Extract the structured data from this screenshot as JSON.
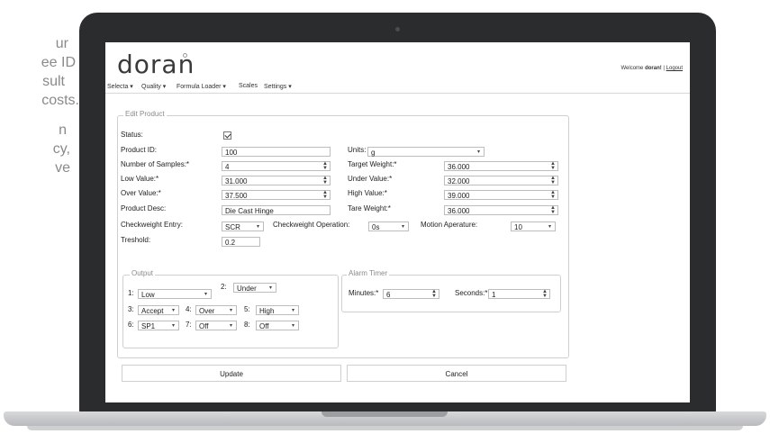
{
  "marketing": {
    "lines": [
      "ur",
      "ee ID",
      "sult",
      "costs.",
      "n",
      "cy,",
      "ve"
    ]
  },
  "app": {
    "logo": "doran",
    "welcome_prefix": "Welcome",
    "welcome_user": "doran!",
    "separator": "|",
    "logout": "Logout"
  },
  "menu": [
    "Selecta ▾",
    "Quality ▾",
    "Formula Loader ▾",
    "Scales",
    "Settings ▾"
  ],
  "form": {
    "legend": "Edit Product",
    "status_label": "Status:",
    "product_id_label": "Product ID:",
    "product_id": "100",
    "units_label": "Units:",
    "units": "g",
    "samples_label": "Number of Samples:*",
    "samples": "4",
    "target_label": "Target Weight:*",
    "target": "36.000",
    "low_label": "Low Value:*",
    "low": "31.000",
    "under_label": "Under Value:*",
    "under": "32.000",
    "over_label": "Over Value:*",
    "over": "37.500",
    "high_label": "High Value:*",
    "high": "39.000",
    "desc_label": "Product Desc:",
    "desc": "Die Cast Hinge",
    "tare_label": "Tare Weight:*",
    "tare": "36.000",
    "cw_entry_label": "Checkweight Entry:",
    "cw_entry": "SCR",
    "cw_op_label": "Checkweight Operation:",
    "cw_op": "0s",
    "motion_label": "Motion Aperature:",
    "motion": "10",
    "treshold_label": "Treshold:",
    "treshold": "0.2"
  },
  "output": {
    "legend": "Output",
    "items": [
      {
        "n": "1:",
        "v": "Low"
      },
      {
        "n": "2:",
        "v": "Under"
      },
      {
        "n": "3:",
        "v": "Accept"
      },
      {
        "n": "4:",
        "v": "Over"
      },
      {
        "n": "5:",
        "v": "High"
      },
      {
        "n": "6:",
        "v": "SP1"
      },
      {
        "n": "7:",
        "v": "Off"
      },
      {
        "n": "8:",
        "v": "Off"
      }
    ]
  },
  "alarm": {
    "legend": "Alarm Timer",
    "minutes_label": "Minutes:*",
    "minutes": "6",
    "seconds_label": "Seconds:*",
    "seconds": "1"
  },
  "buttons": {
    "update": "Update",
    "cancel": "Cancel"
  }
}
